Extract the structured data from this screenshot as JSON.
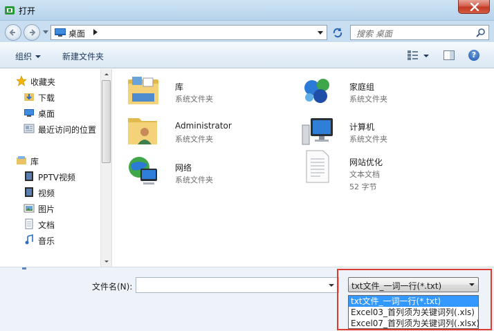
{
  "window": {
    "title": "打开",
    "close_label": "✕"
  },
  "address": {
    "location": "桌面",
    "search_placeholder": "搜索 桌面"
  },
  "toolbar": {
    "organize_label": "组织",
    "new_folder_label": "新建文件夹",
    "help_label": "?"
  },
  "sidebar": {
    "favorites_header": "收藏夹",
    "favorites": [
      {
        "label": "下载",
        "icon": "download-folder-icon"
      },
      {
        "label": "桌面",
        "icon": "desktop-icon"
      },
      {
        "label": "最近访问的位置",
        "icon": "recent-places-icon"
      }
    ],
    "libraries_header": "库",
    "libraries": [
      {
        "label": "PPTV视频",
        "icon": "video-library-icon"
      },
      {
        "label": "视频",
        "icon": "video-library-icon"
      },
      {
        "label": "图片",
        "icon": "pictures-library-icon"
      },
      {
        "label": "文档",
        "icon": "documents-library-icon"
      },
      {
        "label": "音乐",
        "icon": "music-library-icon"
      }
    ]
  },
  "items": [
    {
      "name": "库",
      "sub": "系统文件夹",
      "icon": "libraries-icon"
    },
    {
      "name": "家庭组",
      "sub": "系统文件夹",
      "icon": "homegroup-icon"
    },
    {
      "name": "Administrator",
      "sub": "系统文件夹",
      "icon": "user-folder-icon"
    },
    {
      "name": "计算机",
      "sub": "系统文件夹",
      "icon": "computer-icon"
    },
    {
      "name": "网络",
      "sub": "系统文件夹",
      "icon": "network-icon"
    },
    {
      "name": "网站优化",
      "sub": "文本文档",
      "sub2": "52 字节",
      "icon": "text-document-icon"
    }
  ],
  "bottom": {
    "filename_label": "文件名(N):",
    "filename_value": "",
    "filter_selected": "txt文件_一词一行(*.txt)",
    "filter_options": [
      "txt文件_一词一行(*.txt)",
      "Excel03_首列须为关键词列(.xls)",
      "Excel07_首列须为关键词列(.xlsx)"
    ]
  },
  "colors": {
    "selection": "#3399ff",
    "highlight_box": "#e03a2e"
  }
}
